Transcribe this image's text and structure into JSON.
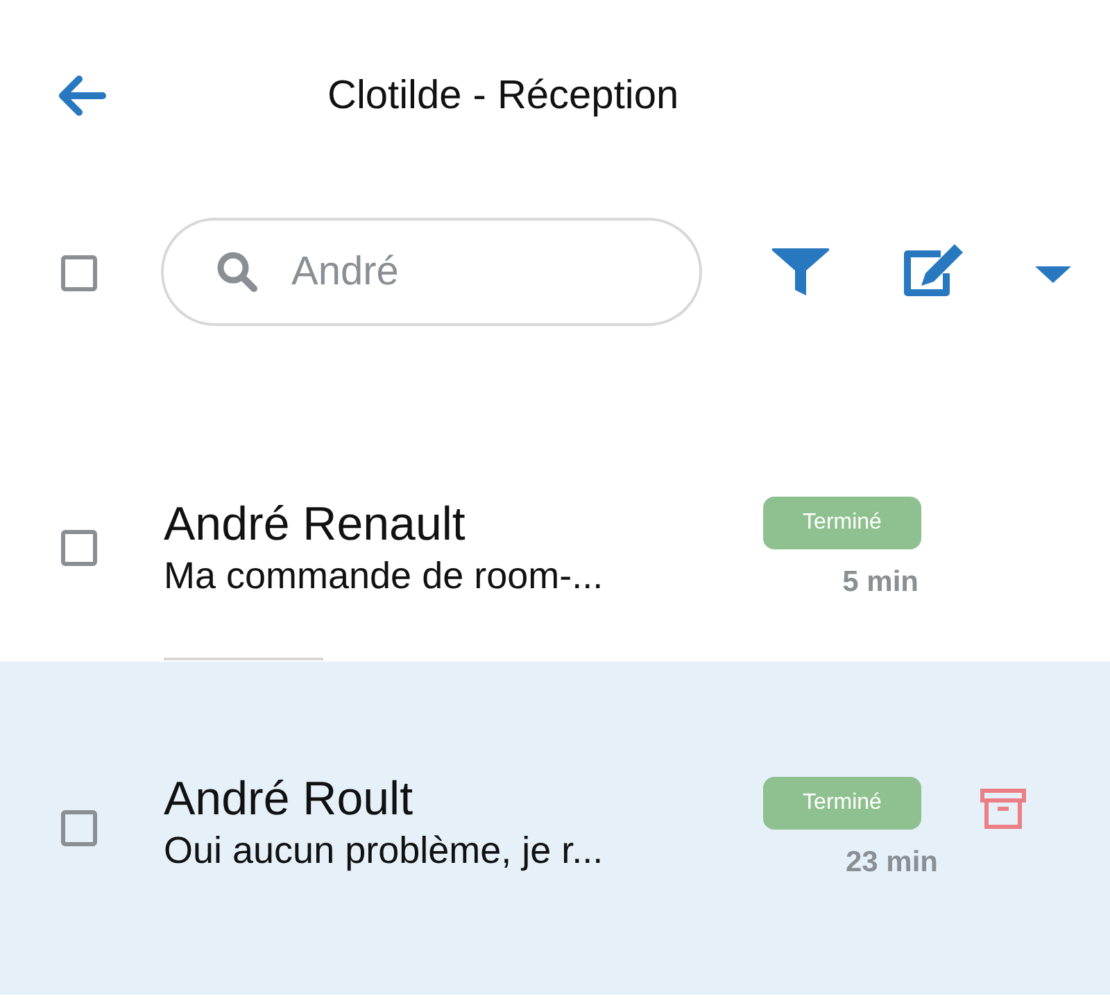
{
  "header": {
    "title": "Clotilde - Réception"
  },
  "toolbar": {
    "select_all": {
      "checked": false
    },
    "search": {
      "value": "André"
    }
  },
  "conversations": [
    {
      "name": "André Renault",
      "preview": "Ma commande de room-...",
      "status": "Terminé",
      "time": "5 min",
      "checked": false,
      "selected": false
    },
    {
      "name": "André Roult",
      "preview": "Oui aucun problème, je r...",
      "status": "Terminé",
      "time": "23 min",
      "checked": false,
      "selected": true
    }
  ]
}
